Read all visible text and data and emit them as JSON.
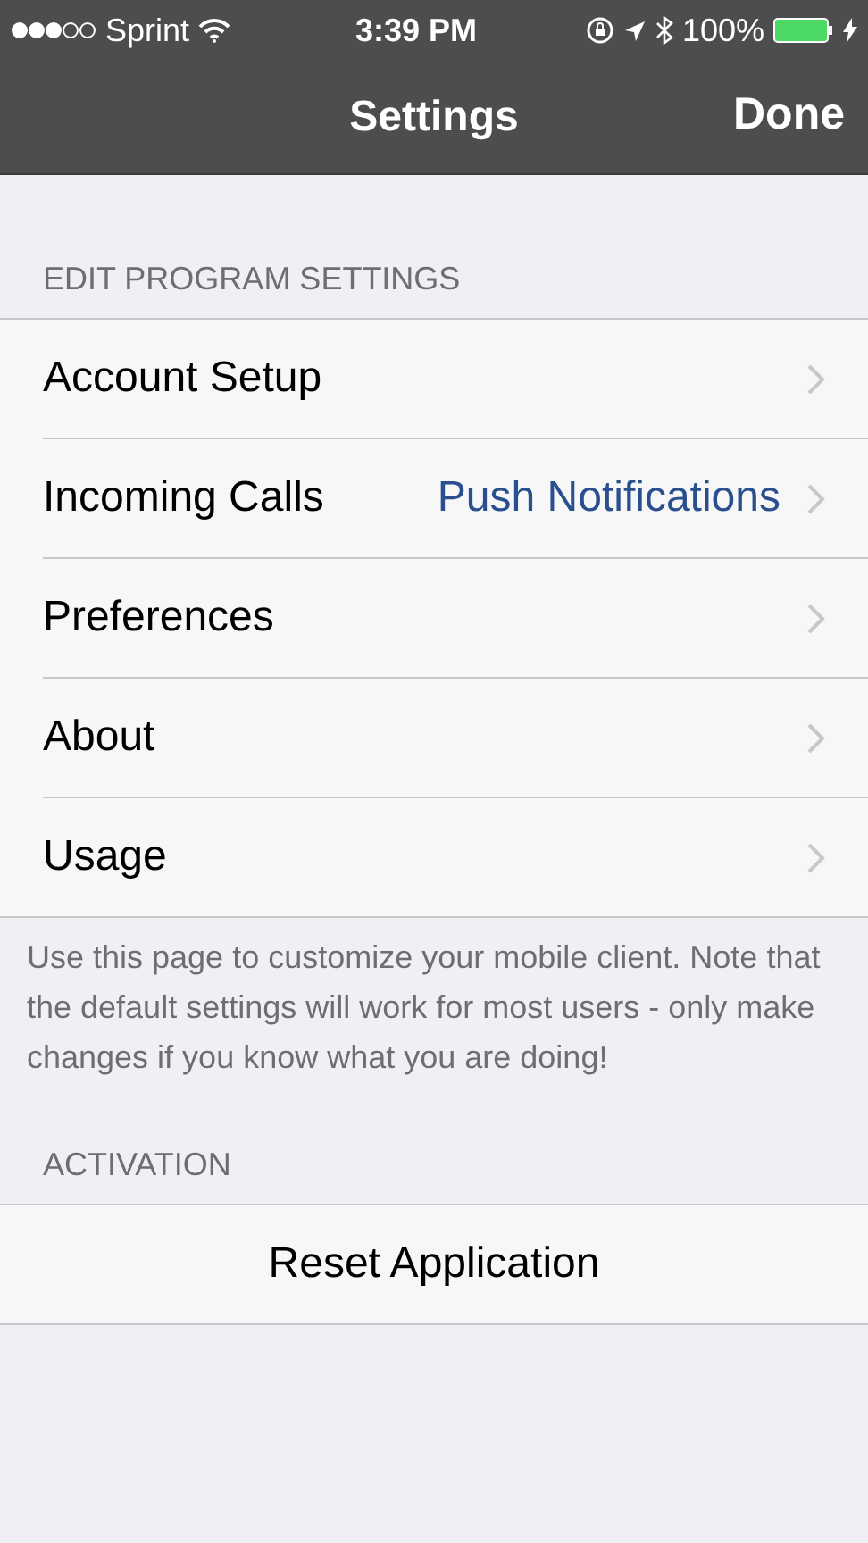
{
  "status_bar": {
    "carrier": "Sprint",
    "time": "3:39 PM",
    "battery": "100%"
  },
  "nav_bar": {
    "title": "Settings",
    "done": "Done"
  },
  "sections": [
    {
      "header": "EDIT PROGRAM SETTINGS",
      "kind": "list",
      "rows": [
        {
          "label": "Account Setup"
        },
        {
          "label": "Incoming Calls",
          "value": "Push Notifications"
        },
        {
          "label": "Preferences"
        },
        {
          "label": "About"
        },
        {
          "label": "Usage"
        }
      ],
      "footer": "Use this page to customize your mobile client. Note that the default settings will work for most users - only make changes if you know what you are doing!"
    },
    {
      "header": "ACTIVATION",
      "kind": "action",
      "rows": [
        {
          "label": "Reset Application"
        }
      ]
    }
  ]
}
